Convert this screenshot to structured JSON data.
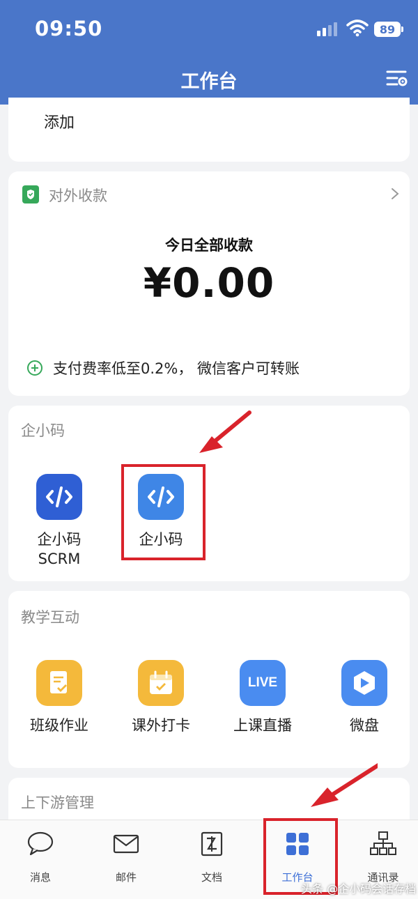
{
  "status_bar": {
    "time": "09:50",
    "battery": "89"
  },
  "nav": {
    "title": "工作台"
  },
  "top_card": {
    "add_label": "添加"
  },
  "payment": {
    "title": "对外收款",
    "today_label": "今日全部收款",
    "amount": "¥0.00",
    "promo": "支付费率低至0.2%， 微信客户可转账"
  },
  "qixiaoma_section": {
    "title": "企小码",
    "apps": [
      {
        "label": "企小码\nSCRM",
        "icon": "code-icon",
        "color": "#2f5fd4"
      },
      {
        "label": "企小码",
        "icon": "code-icon",
        "color": "#3f86e6"
      }
    ]
  },
  "teaching_section": {
    "title": "教学互动",
    "apps": [
      {
        "label": "班级作业",
        "icon": "homework-icon",
        "color": "#f4b93b"
      },
      {
        "label": "课外打卡",
        "icon": "checkin-icon",
        "color": "#f4b93b"
      },
      {
        "label": "上课直播",
        "icon": "live-icon",
        "badge": "LIVE",
        "color": "#4a8cf0"
      },
      {
        "label": "微盘",
        "icon": "drive-icon",
        "color": "#4a8cf0"
      }
    ]
  },
  "supply_section": {
    "title": "上下游管理"
  },
  "tabbar": {
    "items": [
      {
        "label": "消息",
        "icon": "chat-icon"
      },
      {
        "label": "邮件",
        "icon": "mail-icon"
      },
      {
        "label": "文档",
        "icon": "document-icon"
      },
      {
        "label": "工作台",
        "icon": "grid-icon",
        "active": true
      },
      {
        "label": "通讯录",
        "icon": "org-chart-icon"
      }
    ]
  },
  "watermark": "头条 @企小码会话存档",
  "colors": {
    "primary": "#4a76c9",
    "accent": "#3d6fd6",
    "highlight": "#d9232b"
  }
}
